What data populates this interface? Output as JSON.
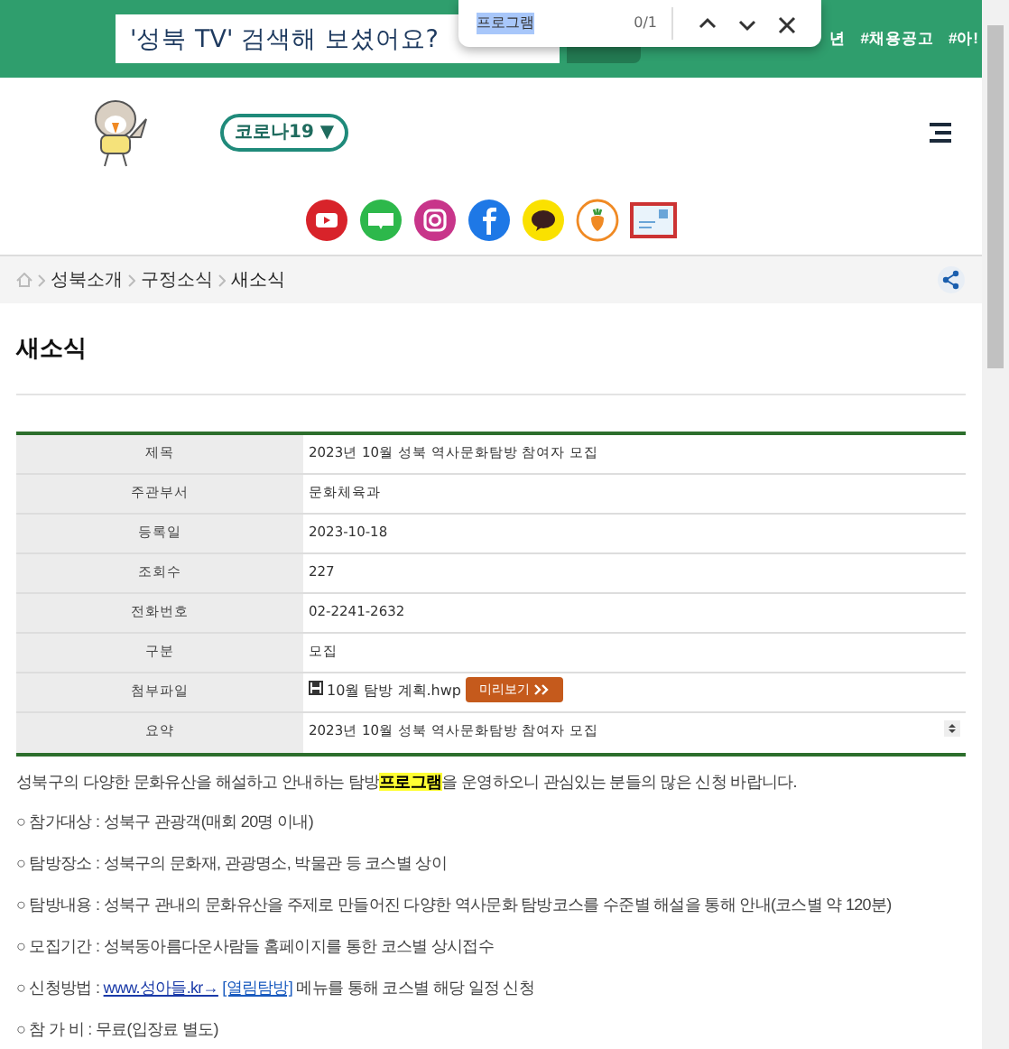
{
  "header": {
    "search": {
      "value": "'성북 TV' 검색해 보셨어요?"
    },
    "hashtags": [
      "년",
      "#채용공고",
      "#아!"
    ]
  },
  "find_bar": {
    "query": "프로그램",
    "count": "0/1"
  },
  "corona_button": {
    "label": "코로나19 ▼"
  },
  "social_icons": [
    {
      "kind": "youtube",
      "color": "#d8232a"
    },
    {
      "kind": "blog",
      "color": "#2db84b"
    },
    {
      "kind": "instagram",
      "color": "#c8358a"
    },
    {
      "kind": "facebook",
      "color": "#1e78e6"
    },
    {
      "kind": "kakao",
      "color": "#fae100"
    },
    {
      "kind": "carrot",
      "color": "#f08a24"
    },
    {
      "kind": "mail",
      "color": "#cc3333"
    }
  ],
  "breadcrumb": [
    "성북소개",
    "구정소식",
    "새소식"
  ],
  "page_title": "새소식",
  "details": [
    {
      "label": "제목",
      "value": "2023년 10월 성북 역사문화탐방 참여자 모집"
    },
    {
      "label": "주관부서",
      "value": "문화체육과"
    },
    {
      "label": "등록일",
      "value": "2023-10-18"
    },
    {
      "label": "조회수",
      "value": "227"
    },
    {
      "label": "전화번호",
      "value": "02-2241-2632"
    },
    {
      "label": "구분",
      "value": "모집"
    },
    {
      "label": "첨부파일",
      "kind": "file",
      "value": "10월 탐방 계획.hwp",
      "button": "미리보기"
    },
    {
      "label": "요약",
      "kind": "summary",
      "value": "2023년 10월 성북 역사문화탐방 참여자 모집"
    }
  ],
  "intro": "성북구의 다양한 문화유산을 해설하고 안내하는 탐방**프로그램**을 운영하오니 관심있는 분들의 많은 신청 바랍니다.",
  "items": [
    {
      "marker": "○",
      "text": "참가대상 : 성북구 관광객(매회 20명 이내)"
    },
    {
      "marker": "○",
      "text": "탐방장소 : 성북구의 문화재, 관광명소, 박물관 등 코스별 상이"
    },
    {
      "marker": "○",
      "text": "탐방내용 : 성북구 관내의 문화유산을 주제로 만들어진 다양한 역사문화 탐방코스를 수준별 해설을 통해 안내(코스별 약 120분)"
    },
    {
      "marker": "○",
      "text": "모집기간 : 성북동아름다운사람들 홈페이지를 통한 코스별 상시접수"
    },
    {
      "marker": "○",
      "text": "신청방법 : ",
      "link": "www.성아들.kr→",
      "link2": "[열림탐방]",
      "after": " 메뉴를 통해 코스별 해당 일정 신청"
    },
    {
      "marker": "○",
      "text": "참 가 비 : 무료(입장료 별도)"
    }
  ]
}
